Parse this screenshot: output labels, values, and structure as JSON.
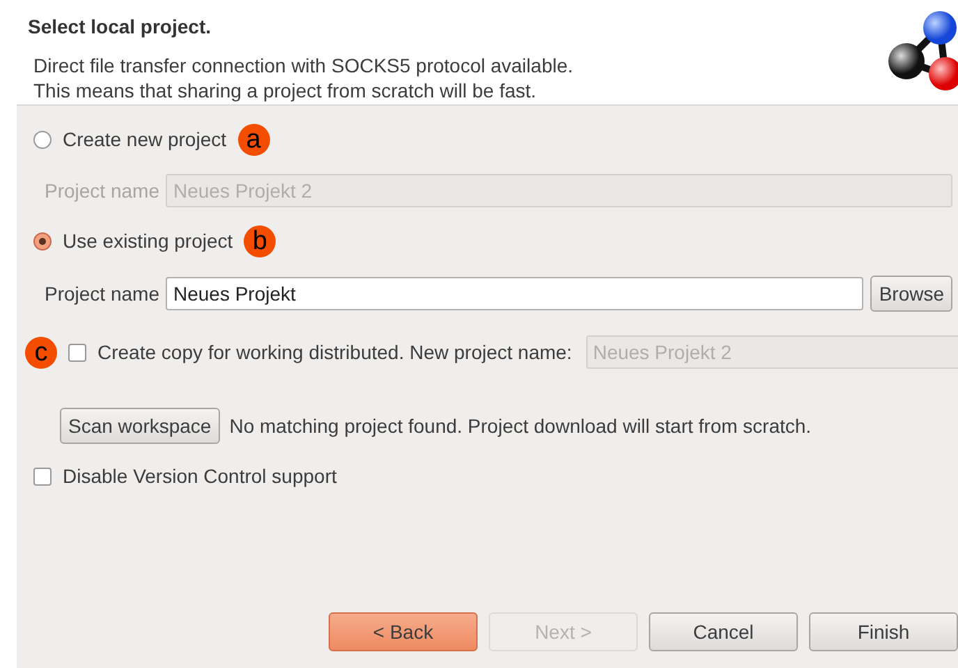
{
  "header": {
    "title": "Select local project.",
    "description": "Direct file transfer connection with SOCKS5 protocol available.\nThis means that sharing a project from scratch will be fast."
  },
  "options": [
    {
      "kind": "radio",
      "label": "Create new project",
      "selected": false,
      "marker": "a",
      "field": {
        "label": "Project name",
        "value": "Neues Projekt 2",
        "disabled": true
      }
    },
    {
      "kind": "radio",
      "label": "Use existing project",
      "selected": true,
      "marker": "b",
      "field": {
        "label": "Project name",
        "value": "Neues Projekt",
        "disabled": false,
        "button": "Browse"
      }
    }
  ],
  "copy": {
    "marker": "c",
    "label": "Create copy for working distributed. New project name:",
    "checked": false,
    "field": {
      "value": "Neues Projekt 2",
      "disabled": true
    }
  },
  "scan": {
    "button": "Scan workspace",
    "message": "No matching project found. Project download will start from scratch."
  },
  "vcs": {
    "label": "Disable Version Control support",
    "checked": false
  },
  "buttons": [
    {
      "label": "< Back",
      "kind": "default",
      "disabled": false
    },
    {
      "label": "Next >",
      "kind": "normal",
      "disabled": true
    },
    {
      "label": "Cancel",
      "kind": "normal",
      "disabled": false
    },
    {
      "label": "Finish",
      "kind": "normal",
      "disabled": false
    }
  ]
}
